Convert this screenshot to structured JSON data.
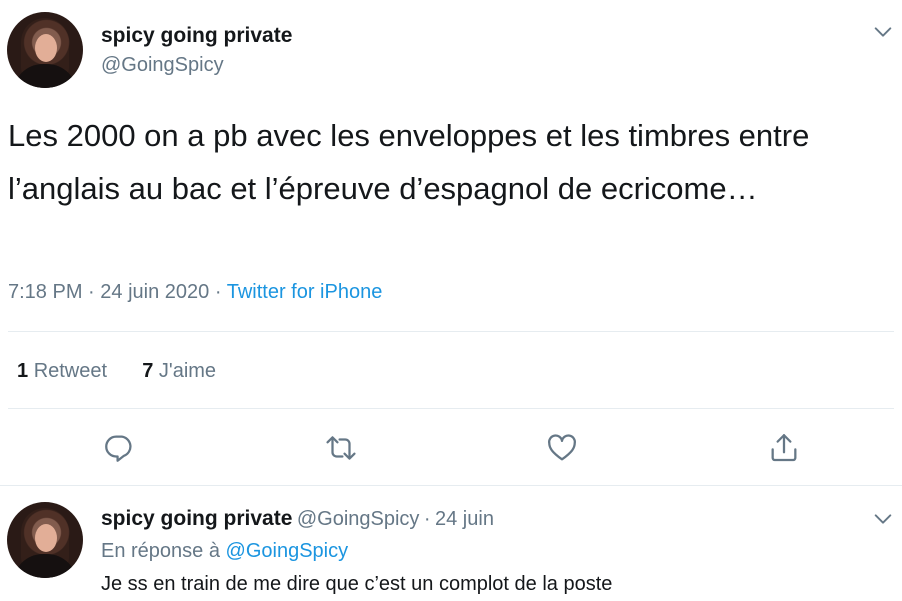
{
  "tweet": {
    "author_name": "spicy going private",
    "author_handle": "@GoingSpicy",
    "text": "Les 2000 on a pb avec les enveloppes et les timbres entre l’anglais au bac et l’épreuve d’espagnol de ecricome…",
    "time": "7:18 PM",
    "date": "24 juin 2020",
    "separator": "·",
    "source": "Twitter for iPhone",
    "retweet_count": "1",
    "retweet_label": "Retweet",
    "like_count": "7",
    "like_label": "J'aime"
  },
  "icons": {
    "menu": "chevron-down-icon",
    "reply": "reply-icon",
    "retweet": "retweet-icon",
    "like": "heart-icon",
    "share": "share-icon"
  },
  "reply": {
    "author_name": "spicy going private",
    "author_handle": "@GoingSpicy",
    "separator": "·",
    "date": "24 juin",
    "context_prefix": "En réponse à",
    "context_handle": "@GoingSpicy",
    "text": "Je ss en train de me dire que c’est un complot de la poste"
  },
  "colors": {
    "text": "#14171a",
    "secondary": "#657786",
    "link": "#1b95e0",
    "divider": "#e6ecf0"
  }
}
